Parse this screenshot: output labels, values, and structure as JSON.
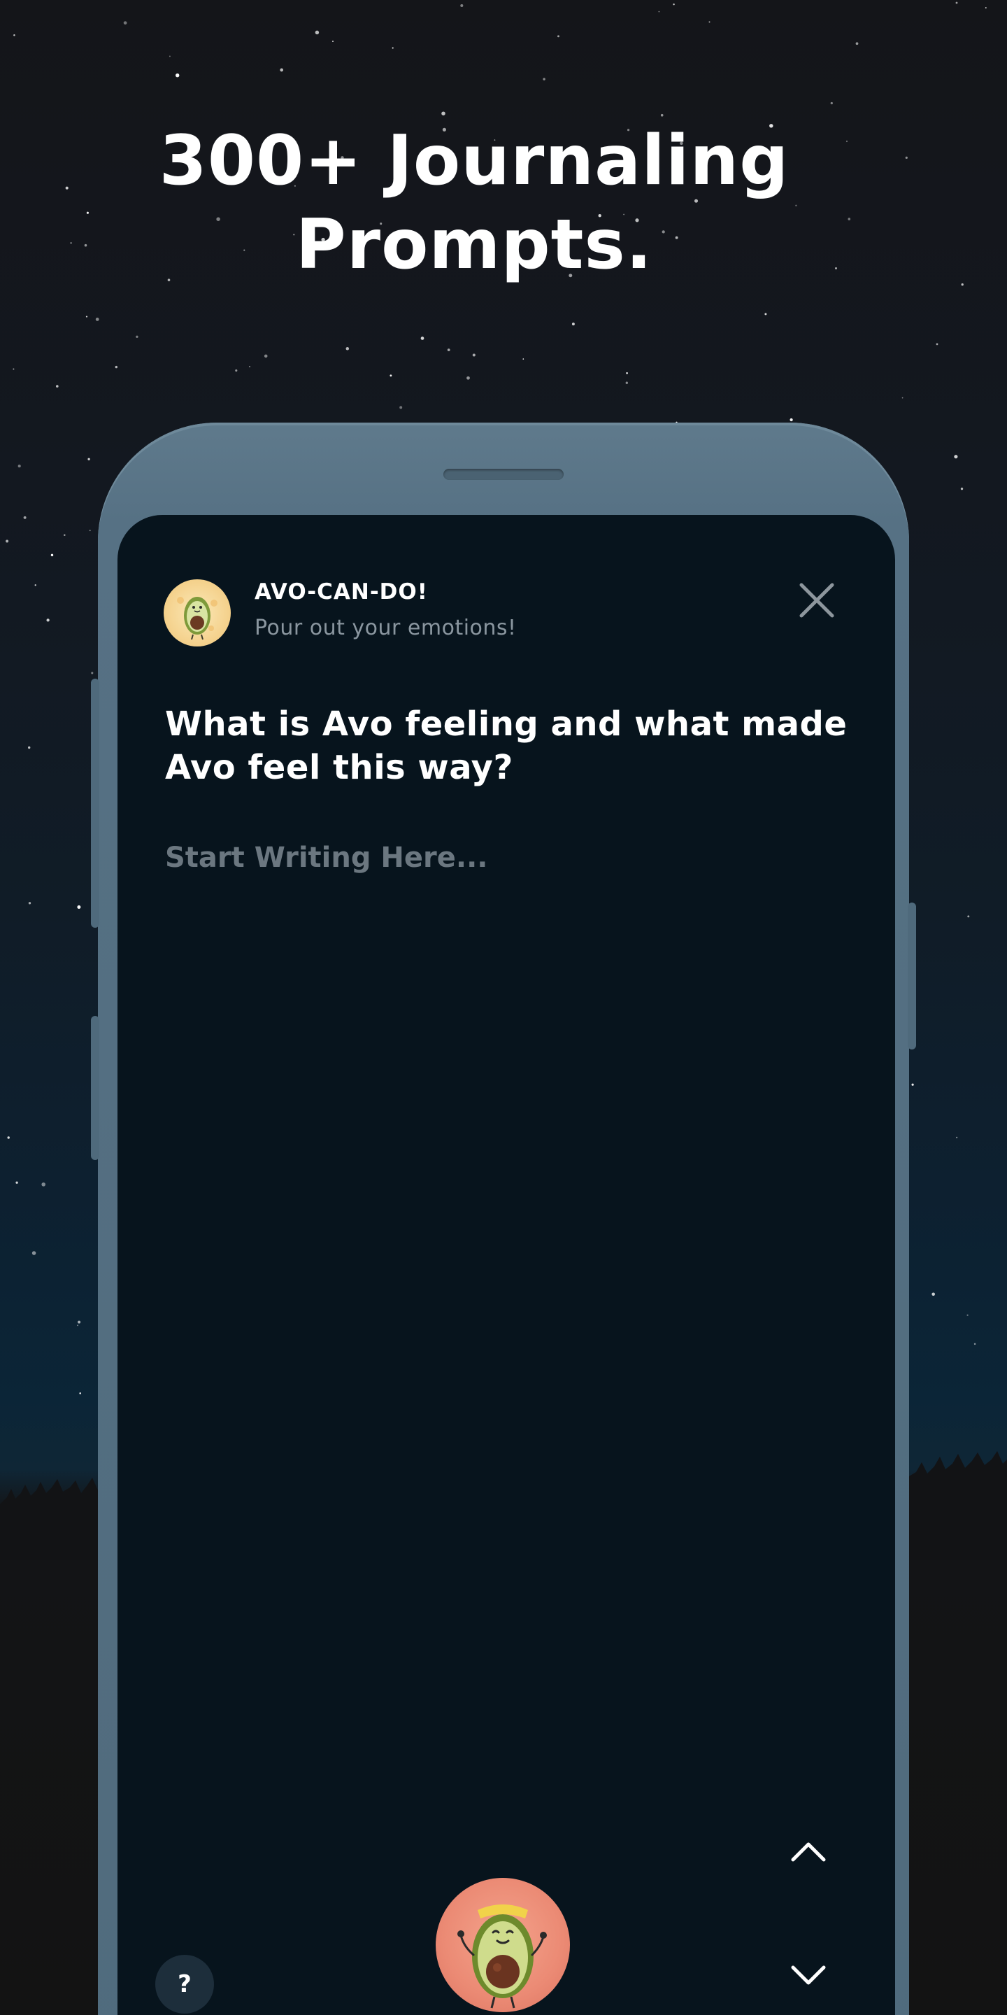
{
  "headline": {
    "line1": "300+ Journaling",
    "line2": "Prompts."
  },
  "card": {
    "app_name": "AVO-CAN-DO!",
    "tagline": "Pour out your emotions!",
    "prompt": "What is Avo feeling and what made Avo feel this way?",
    "input_placeholder": "Start Writing Here...",
    "help_label": "?"
  },
  "icons": {
    "avatar": "avocado-mascot-icon",
    "close": "close-icon",
    "previous": "chevron-up-icon",
    "next": "chevron-down-icon",
    "mascot_button": "avocado-mascot-icon"
  },
  "colors": {
    "screen_background": "#07141d",
    "phone_frame": "#5a7587",
    "mascot_button": "#eb8a74",
    "avatar_background": "#f4d08a"
  }
}
